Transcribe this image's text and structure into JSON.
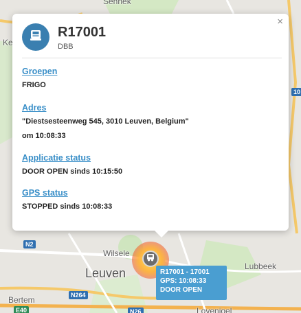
{
  "map": {
    "labels": {
      "top_partial": "Sennek",
      "left_partial": "Ke",
      "wilsele": "Wilsele",
      "leuven": "Leuven",
      "lubbeek": "Lubbeek",
      "bertem": "Bertem",
      "bottom_partial": "Lovenjoel"
    },
    "shields": {
      "n2": "N2",
      "n264": "N264",
      "e40": "E40",
      "n26": "N26",
      "e314_partial": "10"
    }
  },
  "popup": {
    "close_label": "×",
    "title": "R17001",
    "subtitle": "DBB",
    "sections": [
      {
        "title": "Groepen",
        "values": [
          "FRIGO"
        ]
      },
      {
        "title": "Adres",
        "values": [
          "\"Diestsesteenweg 545, 3010 Leuven, Belgium\"",
          "om 10:08:33"
        ]
      },
      {
        "title": "Applicatie status",
        "values": [
          "DOOR OPEN sinds 10:15:50"
        ]
      },
      {
        "title": "GPS status",
        "values": [
          "STOPPED sinds 10:08:33"
        ]
      }
    ]
  },
  "marker": {
    "line1": "R17001 - 17001",
    "line2": "GPS: 10:08:33",
    "line3": "DOOR OPEN",
    "icon": "truck-icon"
  },
  "colors": {
    "accent": "#3a8fc8",
    "badge": "#3a7fb0",
    "label_bg": "#4a9ed1"
  }
}
